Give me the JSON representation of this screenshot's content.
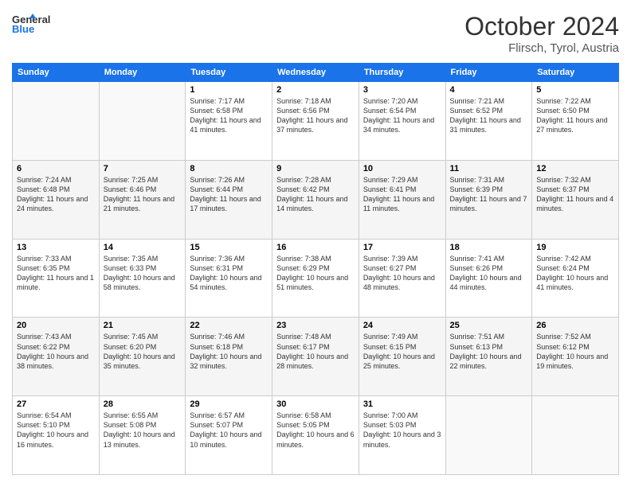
{
  "header": {
    "logo_line1": "General",
    "logo_line2": "Blue",
    "month": "October 2024",
    "location": "Flirsch, Tyrol, Austria"
  },
  "weekdays": [
    "Sunday",
    "Monday",
    "Tuesday",
    "Wednesday",
    "Thursday",
    "Friday",
    "Saturday"
  ],
  "rows": [
    [
      {
        "day": "",
        "info": ""
      },
      {
        "day": "",
        "info": ""
      },
      {
        "day": "1",
        "info": "Sunrise: 7:17 AM\nSunset: 6:58 PM\nDaylight: 11 hours and 41 minutes."
      },
      {
        "day": "2",
        "info": "Sunrise: 7:18 AM\nSunset: 6:56 PM\nDaylight: 11 hours and 37 minutes."
      },
      {
        "day": "3",
        "info": "Sunrise: 7:20 AM\nSunset: 6:54 PM\nDaylight: 11 hours and 34 minutes."
      },
      {
        "day": "4",
        "info": "Sunrise: 7:21 AM\nSunset: 6:52 PM\nDaylight: 11 hours and 31 minutes."
      },
      {
        "day": "5",
        "info": "Sunrise: 7:22 AM\nSunset: 6:50 PM\nDaylight: 11 hours and 27 minutes."
      }
    ],
    [
      {
        "day": "6",
        "info": "Sunrise: 7:24 AM\nSunset: 6:48 PM\nDaylight: 11 hours and 24 minutes."
      },
      {
        "day": "7",
        "info": "Sunrise: 7:25 AM\nSunset: 6:46 PM\nDaylight: 11 hours and 21 minutes."
      },
      {
        "day": "8",
        "info": "Sunrise: 7:26 AM\nSunset: 6:44 PM\nDaylight: 11 hours and 17 minutes."
      },
      {
        "day": "9",
        "info": "Sunrise: 7:28 AM\nSunset: 6:42 PM\nDaylight: 11 hours and 14 minutes."
      },
      {
        "day": "10",
        "info": "Sunrise: 7:29 AM\nSunset: 6:41 PM\nDaylight: 11 hours and 11 minutes."
      },
      {
        "day": "11",
        "info": "Sunrise: 7:31 AM\nSunset: 6:39 PM\nDaylight: 11 hours and 7 minutes."
      },
      {
        "day": "12",
        "info": "Sunrise: 7:32 AM\nSunset: 6:37 PM\nDaylight: 11 hours and 4 minutes."
      }
    ],
    [
      {
        "day": "13",
        "info": "Sunrise: 7:33 AM\nSunset: 6:35 PM\nDaylight: 11 hours and 1 minute."
      },
      {
        "day": "14",
        "info": "Sunrise: 7:35 AM\nSunset: 6:33 PM\nDaylight: 10 hours and 58 minutes."
      },
      {
        "day": "15",
        "info": "Sunrise: 7:36 AM\nSunset: 6:31 PM\nDaylight: 10 hours and 54 minutes."
      },
      {
        "day": "16",
        "info": "Sunrise: 7:38 AM\nSunset: 6:29 PM\nDaylight: 10 hours and 51 minutes."
      },
      {
        "day": "17",
        "info": "Sunrise: 7:39 AM\nSunset: 6:27 PM\nDaylight: 10 hours and 48 minutes."
      },
      {
        "day": "18",
        "info": "Sunrise: 7:41 AM\nSunset: 6:26 PM\nDaylight: 10 hours and 44 minutes."
      },
      {
        "day": "19",
        "info": "Sunrise: 7:42 AM\nSunset: 6:24 PM\nDaylight: 10 hours and 41 minutes."
      }
    ],
    [
      {
        "day": "20",
        "info": "Sunrise: 7:43 AM\nSunset: 6:22 PM\nDaylight: 10 hours and 38 minutes."
      },
      {
        "day": "21",
        "info": "Sunrise: 7:45 AM\nSunset: 6:20 PM\nDaylight: 10 hours and 35 minutes."
      },
      {
        "day": "22",
        "info": "Sunrise: 7:46 AM\nSunset: 6:18 PM\nDaylight: 10 hours and 32 minutes."
      },
      {
        "day": "23",
        "info": "Sunrise: 7:48 AM\nSunset: 6:17 PM\nDaylight: 10 hours and 28 minutes."
      },
      {
        "day": "24",
        "info": "Sunrise: 7:49 AM\nSunset: 6:15 PM\nDaylight: 10 hours and 25 minutes."
      },
      {
        "day": "25",
        "info": "Sunrise: 7:51 AM\nSunset: 6:13 PM\nDaylight: 10 hours and 22 minutes."
      },
      {
        "day": "26",
        "info": "Sunrise: 7:52 AM\nSunset: 6:12 PM\nDaylight: 10 hours and 19 minutes."
      }
    ],
    [
      {
        "day": "27",
        "info": "Sunrise: 6:54 AM\nSunset: 5:10 PM\nDaylight: 10 hours and 16 minutes."
      },
      {
        "day": "28",
        "info": "Sunrise: 6:55 AM\nSunset: 5:08 PM\nDaylight: 10 hours and 13 minutes."
      },
      {
        "day": "29",
        "info": "Sunrise: 6:57 AM\nSunset: 5:07 PM\nDaylight: 10 hours and 10 minutes."
      },
      {
        "day": "30",
        "info": "Sunrise: 6:58 AM\nSunset: 5:05 PM\nDaylight: 10 hours and 6 minutes."
      },
      {
        "day": "31",
        "info": "Sunrise: 7:00 AM\nSunset: 5:03 PM\nDaylight: 10 hours and 3 minutes."
      },
      {
        "day": "",
        "info": ""
      },
      {
        "day": "",
        "info": ""
      }
    ]
  ]
}
